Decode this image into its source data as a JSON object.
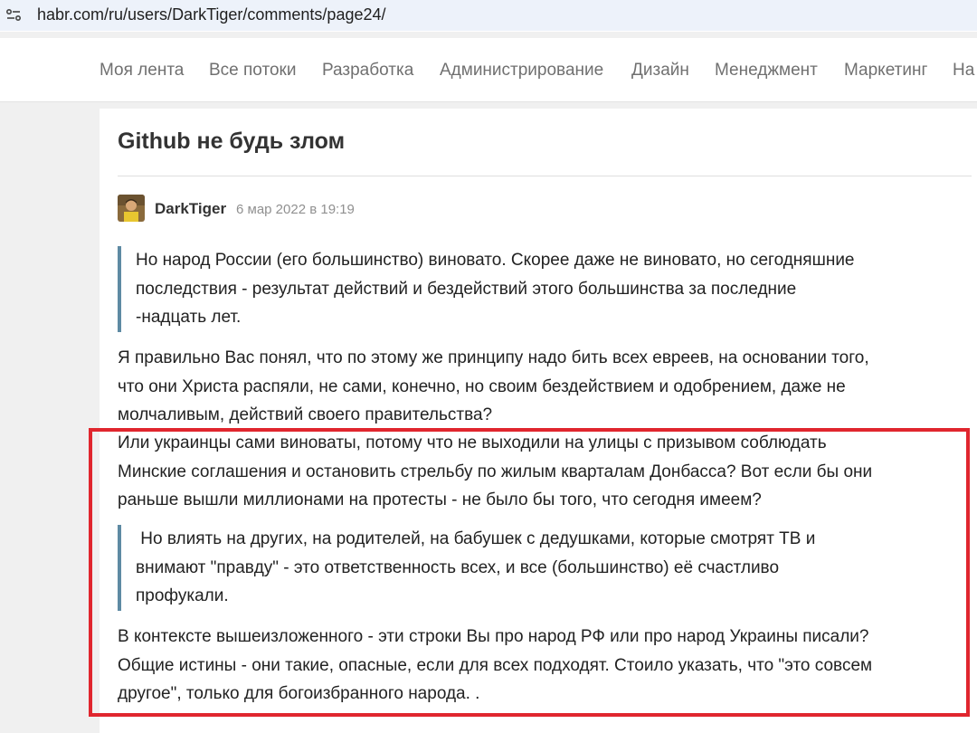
{
  "browser": {
    "url": "habr.com/ru/users/DarkTiger/comments/page24/",
    "site_icon": "site-settings-icon"
  },
  "nav": {
    "items": [
      "Моя лента",
      "Все потоки",
      "Разработка",
      "Администрирование",
      "Дизайн",
      "Менеджмент",
      "Маркетинг",
      "На"
    ]
  },
  "article": {
    "title": "Github не будь злом"
  },
  "comment": {
    "author": "DarkTiger",
    "date": "6 мар 2022 в 19:19",
    "quote1": [
      "Но народ России (его большинство) виновато. Скорее даже не виновато, но сегодняшние",
      "последствия - результат действий и бездействий этого большинства за последние",
      "-надцать лет."
    ],
    "para1": [
      "Я правильно Вас понял, что по этому же принципу надо бить всех евреев, на основании того,",
      "что они Христа распяли, не сами, конечно, но своим бездействием и одобрением, даже не",
      "молчаливым, действий своего правительства?"
    ],
    "para2": [
      "Или украинцы сами виноваты, потому что не выходили на улицы с призывом соблюдать",
      "Минские соглашения и остановить стрельбу по жилым кварталам Донбасса? Вот если бы они",
      "раньше вышли миллионами на протесты - не было бы того, что сегодня имеем?"
    ],
    "quote2": [
      " Но влиять на других, на родителей, на бабушек с дедушками, которые смотрят ТВ и",
      "внимают \"правду\" - это ответственность всех, и все (большинство) её счастливо",
      "профукали."
    ],
    "para3": [
      "В контексте вышеизложенного - эти строки Вы про народ РФ или про народ Украины писали?",
      "Общие истины - они такие, опасные, если для всех подходят. Стоило указать, что \"это совсем",
      "другое\", только для богоизбранного народа. ."
    ]
  },
  "colors": {
    "highlight_border": "#e0262e",
    "quote_bar": "#5e8aa3"
  }
}
